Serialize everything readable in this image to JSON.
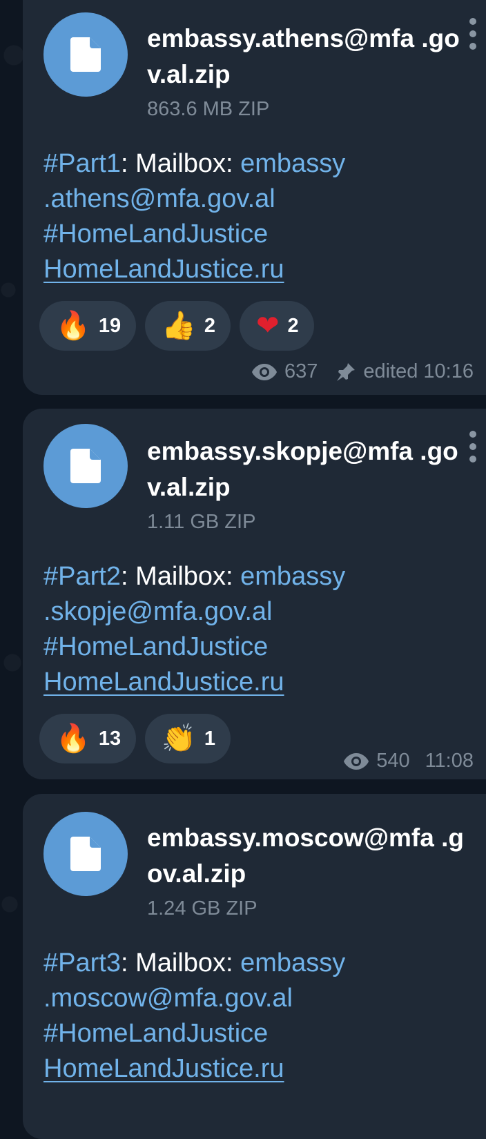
{
  "messages": [
    {
      "file_name": "embassy.athens@mfa .gov.al.zip",
      "file_size": "863.6 MB ZIP",
      "caption": {
        "tag": "#Part1",
        "text": ": Mailbox: ",
        "mail": "embassy .athens@mfa.gov.al",
        "hashtag": "#HomeLandJustice",
        "link": "HomeLandJustice.ru"
      },
      "reactions": [
        {
          "emoji": "🔥",
          "count": "19"
        },
        {
          "emoji": "👍",
          "count": "2"
        },
        {
          "emoji": "❤",
          "count": "2"
        }
      ],
      "views": "637",
      "edited": "edited 10:16"
    },
    {
      "file_name": "embassy.skopje@mfa .gov.al.zip",
      "file_size": "1.11 GB ZIP",
      "caption": {
        "tag": "#Part2",
        "text": ": Mailbox: ",
        "mail": "embassy .skopje@mfa.gov.al",
        "hashtag": "#HomeLandJustice",
        "link": "HomeLandJustice.ru"
      },
      "reactions": [
        {
          "emoji": "🔥",
          "count": "13"
        },
        {
          "emoji": "👏",
          "count": "1"
        }
      ],
      "views": "540",
      "time": "11:08"
    },
    {
      "file_name": "embassy.moscow@mfa .gov.al.zip",
      "file_size": "1.24 GB ZIP",
      "caption": {
        "tag": "#Part3",
        "text": ": Mailbox: ",
        "mail": "embassy .moscow@mfa.gov.al",
        "hashtag": "#HomeLandJustice",
        "link": "HomeLandJustice.ru"
      }
    }
  ],
  "colors": {
    "background": "#0e1621",
    "bubble": "#1f2936",
    "accent_link": "#71b3ea",
    "file_icon": "#5c9bd6",
    "reaction_pill": "#2f3c4b",
    "meta_text": "#7f8b98"
  },
  "icons": [
    "file-icon",
    "more-vertical-icon",
    "eye-icon",
    "pin-icon"
  ]
}
